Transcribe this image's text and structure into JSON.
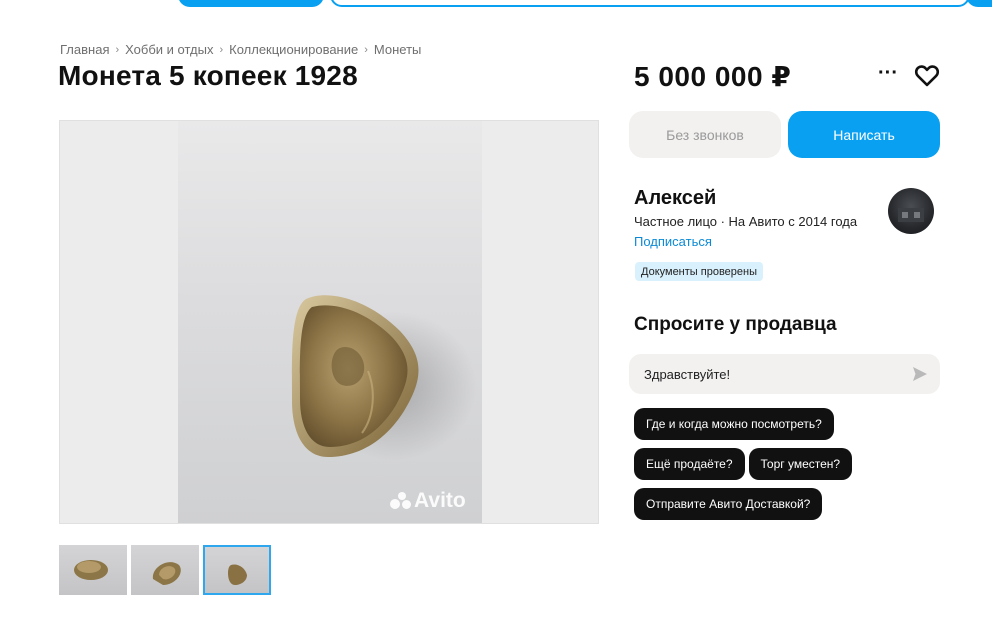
{
  "breadcrumb": [
    "Главная",
    "Хобби и отдых",
    "Коллекционирование",
    "Монеты"
  ],
  "listing": {
    "title": "Монета 5 копеек 1928",
    "price": "5 000 000 ₽"
  },
  "actions": {
    "more_label": "···",
    "no_calls_label": "Без звонков",
    "write_label": "Написать"
  },
  "gallery": {
    "watermark": "Avito",
    "thumbnail_count": 3,
    "active_thumbnail": 3
  },
  "seller": {
    "name": "Алексей",
    "meta": "Частное лицо · На Авито с 2014 года",
    "subscribe_label": "Подписаться",
    "badge": "Документы проверены"
  },
  "ask": {
    "title": "Спросите у продавца",
    "input_value": "Здравствуйте!",
    "quick_questions": [
      "Где и когда можно посмотреть?",
      "Ещё продаёте?",
      "Торг уместен?",
      "Отправите Авито Доставкой?"
    ]
  },
  "colors": {
    "accent": "#0aa0f2",
    "chip_bg": "#111111",
    "badge_bg": "#d9f1fd",
    "link": "#0a8ad6"
  },
  "icons": {
    "favorite": "heart-outline-icon",
    "more": "more-dots-icon",
    "send": "send-arrow-icon"
  }
}
